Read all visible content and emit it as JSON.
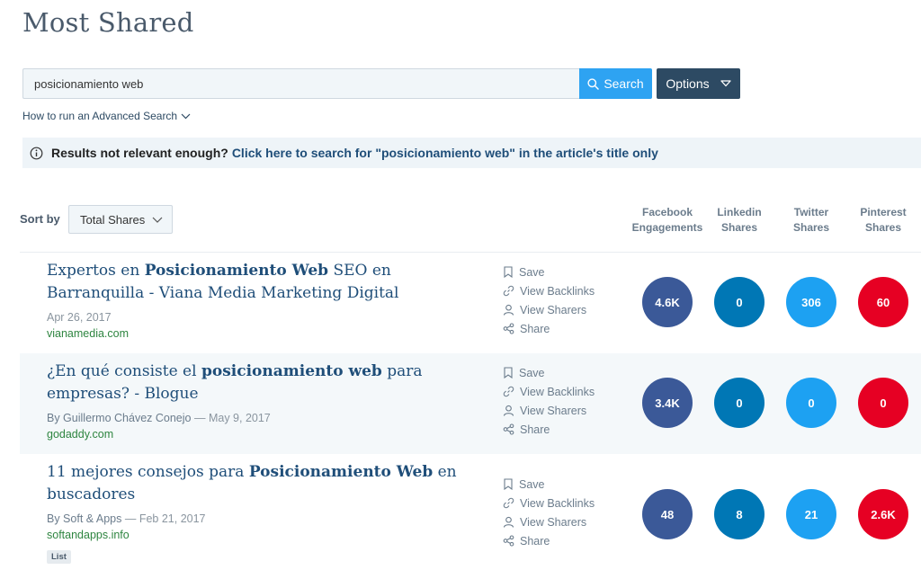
{
  "page": {
    "title": "Most Shared"
  },
  "search": {
    "value": "posicionamiento web",
    "button_label": "Search",
    "options_label": "Options"
  },
  "advanced_link": "How to run an Advanced Search",
  "notice": {
    "text": "Results not relevant enough?",
    "link": "Click here to search for \"posicionamiento web\" in the article's title only"
  },
  "sort": {
    "label": "Sort by",
    "value": "Total Shares"
  },
  "columns": [
    {
      "line1": "Facebook",
      "line2": "Engagements"
    },
    {
      "line1": "Linkedin",
      "line2": "Shares"
    },
    {
      "line1": "Twitter",
      "line2": "Shares"
    },
    {
      "line1": "Pinterest",
      "line2": "Shares"
    }
  ],
  "actions": {
    "save": "Save",
    "backlinks": "View Backlinks",
    "sharers": "View Sharers",
    "share": "Share"
  },
  "colors": {
    "facebook": "#3b5998",
    "linkedin": "#0077b5",
    "twitter": "#1da1f2",
    "pinterest": "#e60023",
    "search": "#2ea3f2",
    "options": "#2d4a63"
  },
  "articles": [
    {
      "title_pre": "Expertos en ",
      "title_bold": "Posicionamiento Web",
      "title_post": " SEO en Barranquilla - Viana Media Marketing Digital",
      "author": "",
      "date": "Apr 26, 2017",
      "domain": "vianamedia.com",
      "tag": "",
      "facebook": "4.6K",
      "linkedin": "0",
      "twitter": "306",
      "pinterest": "60"
    },
    {
      "title_pre": "¿En qué consiste el ",
      "title_bold": "posicionamiento web",
      "title_post": " para empresas? - Blogue",
      "author": "By Guillermo Chávez Conejo",
      "date": "May 9, 2017",
      "domain": "godaddy.com",
      "tag": "",
      "facebook": "3.4K",
      "linkedin": "0",
      "twitter": "0",
      "pinterest": "0"
    },
    {
      "title_pre": "11 mejores consejos para ",
      "title_bold": "Posicionamiento Web",
      "title_post": " en buscadores",
      "author": "By Soft & Apps",
      "date": "Feb 21, 2017",
      "domain": "softandapps.info",
      "tag": "List",
      "facebook": "48",
      "linkedin": "8",
      "twitter": "21",
      "pinterest": "2.6K"
    }
  ]
}
